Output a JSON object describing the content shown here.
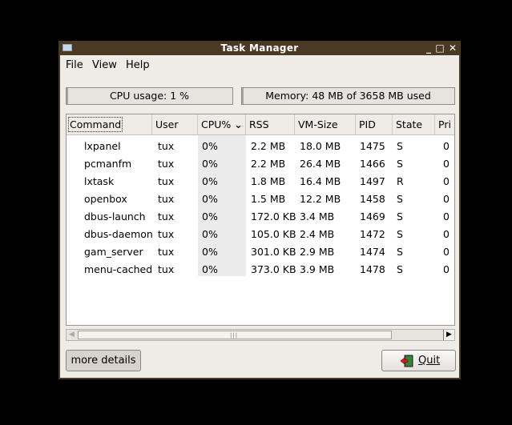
{
  "window": {
    "title": "Task Manager",
    "controls": [
      "_",
      "□",
      "✕"
    ]
  },
  "menubar": {
    "file": "File",
    "view": "View",
    "help": "Help"
  },
  "stats": {
    "cpu": "CPU usage: 1 %",
    "memory": "Memory: 48 MB of 3658 MB used"
  },
  "columns": [
    "Command",
    "User",
    "CPU%",
    "RSS",
    "VM-Size",
    "PID",
    "State",
    "Pri"
  ],
  "sort_indicator": "⌄",
  "processes": [
    {
      "command": "lxpanel",
      "user": "tux",
      "cpu": "0%",
      "rss": "2.2 MB",
      "vm": "18.0 MB",
      "pid": "1475",
      "state": "S",
      "pri": "0"
    },
    {
      "command": "pcmanfm",
      "user": "tux",
      "cpu": "0%",
      "rss": "2.2 MB",
      "vm": "26.4 MB",
      "pid": "1466",
      "state": "S",
      "pri": "0"
    },
    {
      "command": "lxtask",
      "user": "tux",
      "cpu": "0%",
      "rss": "1.8 MB",
      "vm": "16.4 MB",
      "pid": "1497",
      "state": "R",
      "pri": "0"
    },
    {
      "command": "openbox",
      "user": "tux",
      "cpu": "0%",
      "rss": "1.5 MB",
      "vm": "12.2 MB",
      "pid": "1458",
      "state": "S",
      "pri": "0"
    },
    {
      "command": "dbus-launch",
      "user": "tux",
      "cpu": "0%",
      "rss": "172.0 KB",
      "vm": "3.4 MB",
      "pid": "1469",
      "state": "S",
      "pri": "0"
    },
    {
      "command": "dbus-daemon",
      "user": "tux",
      "cpu": "0%",
      "rss": "105.0 KB",
      "vm": "2.4 MB",
      "pid": "1472",
      "state": "S",
      "pri": "0"
    },
    {
      "command": "gam_server",
      "user": "tux",
      "cpu": "0%",
      "rss": "301.0 KB",
      "vm": "2.9 MB",
      "pid": "1474",
      "state": "S",
      "pri": "0"
    },
    {
      "command": "menu-cached",
      "user": "tux",
      "cpu": "0%",
      "rss": "373.0 KB",
      "vm": "3.9 MB",
      "pid": "1478",
      "state": "S",
      "pri": "0"
    }
  ],
  "buttons": {
    "details": "more details",
    "quit": "Quit"
  }
}
